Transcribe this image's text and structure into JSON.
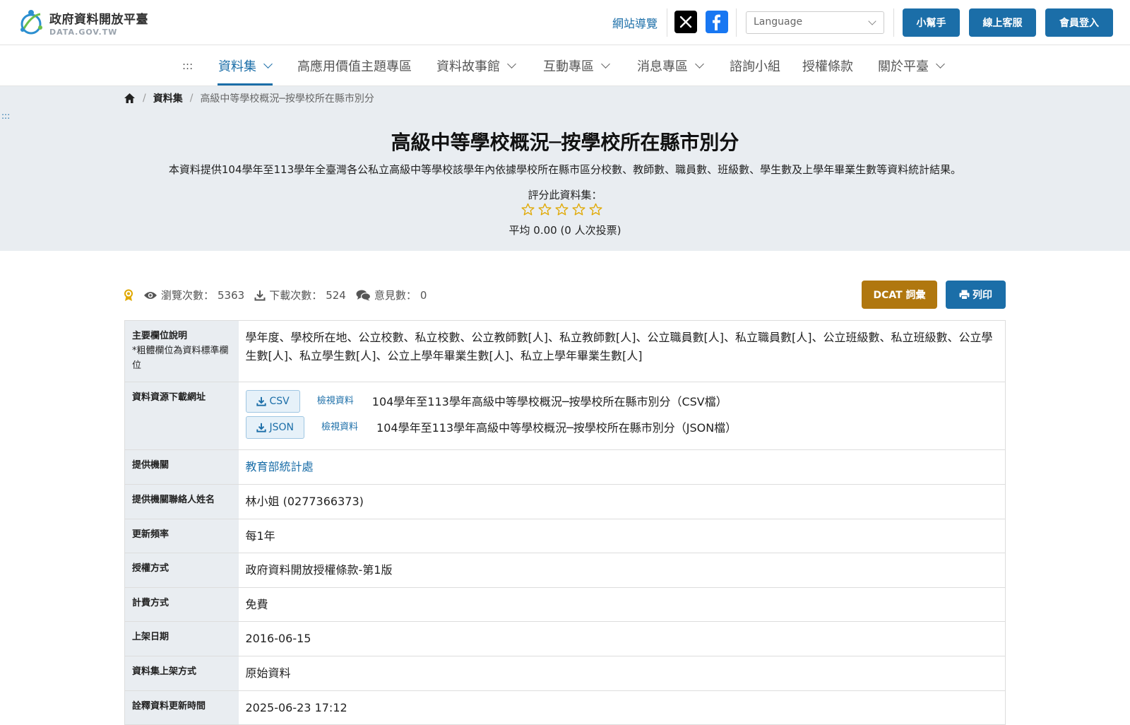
{
  "brand": {
    "name_cn": "政府資料開放平臺",
    "name_en": "DATA.GOV.TW"
  },
  "header": {
    "site_nav": "網站導覽",
    "language_placeholder": "Language",
    "buttons": {
      "helper": "小幫手",
      "support": "線上客服",
      "login": "會員登入"
    }
  },
  "nav": {
    "accesskey": ":::",
    "items": [
      {
        "label": "資料集",
        "dropdown": true,
        "active": true
      },
      {
        "label": "高應用價值主題專區",
        "dropdown": false
      },
      {
        "label": "資料故事館",
        "dropdown": true
      },
      {
        "label": "互動專區",
        "dropdown": true
      },
      {
        "label": "消息專區",
        "dropdown": true
      },
      {
        "label": "諮詢小組",
        "dropdown": false
      },
      {
        "label": "授權條款",
        "dropdown": false
      },
      {
        "label": "關於平臺",
        "dropdown": true
      }
    ]
  },
  "breadcrumb": {
    "level1": "資料集",
    "current": "高級中等學校概況─按學校所在縣市別分"
  },
  "hero": {
    "accesskey": ":::",
    "title": "高級中等學校概況─按學校所在縣市別分",
    "description": "本資料提供104學年至113學年全臺灣各公私立高級中等學校該學年內依據學校所在縣市區分校數、教師數、職員數、班級數、學生數及上學年畢業生數等資料統計結果。",
    "rate_label": "評分此資料集：",
    "rating_value": 0,
    "rating_max": 5,
    "rate_avg": "平均 0.00 (0 人次投票)"
  },
  "stats": {
    "views_label": "瀏覽次數：",
    "views": "5363",
    "downloads_label": "下載次數：",
    "downloads": "524",
    "comments_label": "意見數：",
    "comments": "0"
  },
  "actions": {
    "dcat": "DCAT 詞彙",
    "print": "列印"
  },
  "details": {
    "fields_label": "主要欄位說明",
    "fields_note": "*粗體欄位為資料標準欄位",
    "fields_value": "學年度、學校所在地、公立校數、私立校數、公立教師數[人]、私立教師數[人]、公立職員數[人]、私立職員數[人]、公立班級數、私立班級數、公立學生數[人]、私立學生數[人]、公立上學年畢業生數[人]、私立上學年畢業生數[人]",
    "resources_label": "資料資源下載網址",
    "resources": [
      {
        "format": "CSV",
        "view": "檢視資料",
        "name": "104學年至113學年高級中等學校概況─按學校所在縣市別分（CSV檔）"
      },
      {
        "format": "JSON",
        "view": "檢視資料",
        "name": "104學年至113學年高級中等學校概況─按學校所在縣市別分（JSON檔）"
      }
    ],
    "rows": [
      {
        "label": "提供機關",
        "value": "教育部統計處"
      },
      {
        "label": "提供機關聯絡人姓名",
        "value": "林小姐 (0277366373)"
      },
      {
        "label": "更新頻率",
        "value": "每1年"
      },
      {
        "label": "授權方式",
        "value": "政府資料開放授權條款-第1版"
      },
      {
        "label": "計費方式",
        "value": "免費"
      },
      {
        "label": "上架日期",
        "value": "2016-06-15"
      },
      {
        "label": "資料集上架方式",
        "value": "原始資料"
      },
      {
        "label": "詮釋資料更新時間",
        "value": "2025-06-23 17:12"
      }
    ]
  },
  "colors": {
    "primary": "#1b6ea8",
    "dcat": "#b0770f",
    "hero_bg": "#e9edf1",
    "star": "#e0a800"
  }
}
